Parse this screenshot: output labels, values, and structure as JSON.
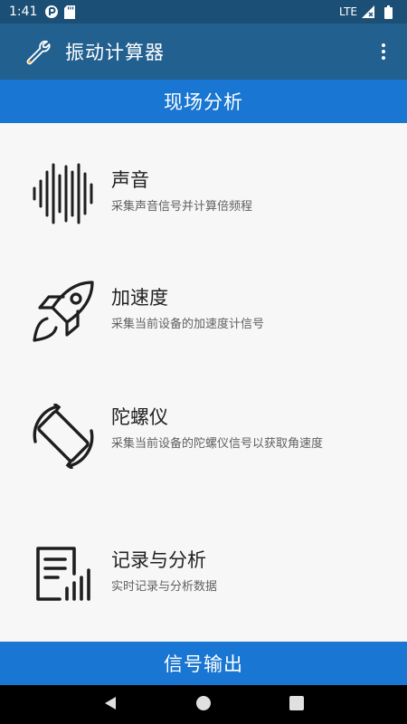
{
  "status_bar": {
    "time": "1:41",
    "network": "LTE"
  },
  "app_bar": {
    "title": "振动计算器",
    "icon": "wrench-icon",
    "menu_icon": "more-vert-icon"
  },
  "section_top": {
    "label": "现场分析"
  },
  "items": [
    {
      "name": "声音",
      "desc": "采集声音信号并计算倍频程",
      "icon": "sound-wave-icon"
    },
    {
      "name": "加速度",
      "desc": "采集当前设备的加速度计信号",
      "icon": "rocket-icon"
    },
    {
      "name": "陀螺仪",
      "desc": "采集当前设备的陀螺仪信号以获取角速度",
      "icon": "rotate-device-icon"
    },
    {
      "name": "记录与分析",
      "desc": "实时记录与分析数据",
      "icon": "report-icon"
    }
  ],
  "section_bottom": {
    "label": "信号输出"
  },
  "colors": {
    "status_bar": "#1c4f75",
    "app_bar": "#22608f",
    "section_header": "#1976d2",
    "background": "#f7f7f7"
  }
}
